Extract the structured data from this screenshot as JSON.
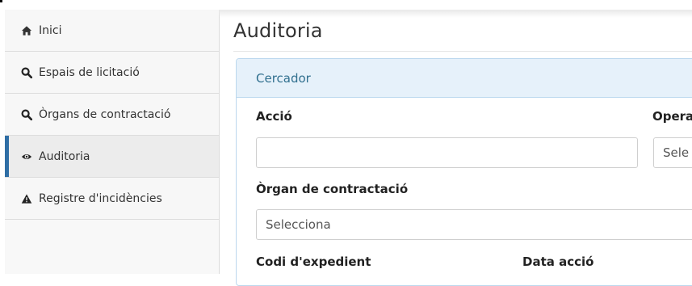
{
  "sidebar": {
    "items": [
      {
        "label": "Inici",
        "icon": "home-icon",
        "active": false
      },
      {
        "label": "Espais de licitació",
        "icon": "search-icon",
        "active": false
      },
      {
        "label": "Òrgans de contractació",
        "icon": "search-icon",
        "active": false
      },
      {
        "label": "Auditoria",
        "icon": "eye-icon",
        "active": true
      },
      {
        "label": "Registre d'incidències",
        "icon": "warning-icon",
        "active": false
      }
    ]
  },
  "main": {
    "title": "Auditoria",
    "panel": {
      "heading": "Cercador",
      "accio_label": "Acció",
      "accio_value": "",
      "operacio_label": "Opera",
      "operacio_value": "Sele",
      "organ_label": "Òrgan de contractació",
      "organ_value": "Selecciona",
      "codi_label": "Codi d'expedient",
      "data_label": "Data acció"
    }
  },
  "colors": {
    "accent": "#2f6ea5",
    "panel_heading_bg": "#e6f1fa",
    "panel_heading_text": "#31708f"
  }
}
